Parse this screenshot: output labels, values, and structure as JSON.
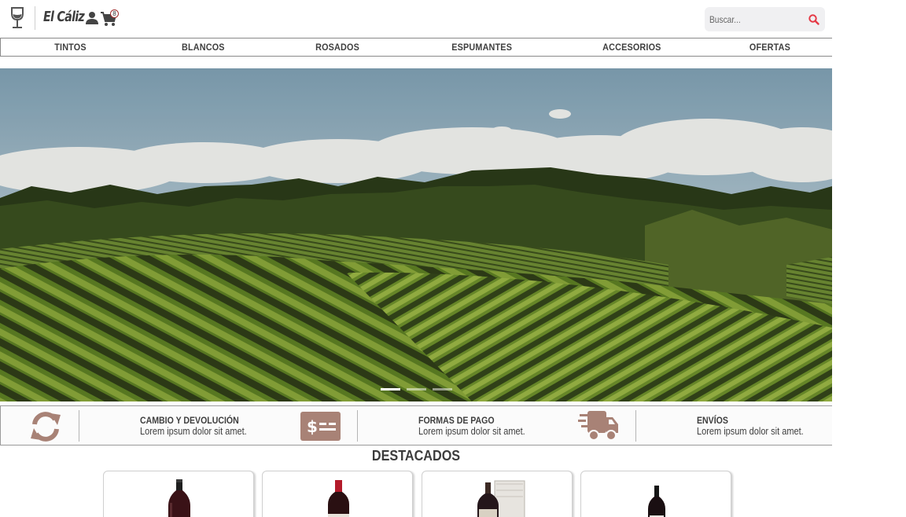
{
  "header": {
    "brand": "El Cáliz",
    "cart_count": "8",
    "search_placeholder": "Buscar..."
  },
  "nav": {
    "items": [
      "TINTOS",
      "BLANCOS",
      "ROSADOS",
      "ESPUMANTES",
      "ACCESORIOS",
      "OFERTAS"
    ]
  },
  "hero": {
    "slides_total": 3,
    "active_slide": 1
  },
  "features": [
    {
      "icon": "refresh-icon",
      "title": "CAMBIO Y DEVOLUCIÓN",
      "subtitle": "Lorem ipsum dolor sit amet."
    },
    {
      "icon": "payment-icon",
      "title": "FORMAS DE PAGO",
      "subtitle": "Lorem ipsum dolor sit amet."
    },
    {
      "icon": "truck-icon",
      "title": "ENVÍOS",
      "subtitle": "Lorem ipsum dolor sit amet."
    }
  ],
  "featured": {
    "title": "DESTACADOS",
    "products": [
      {
        "image": "wine-bottle-image"
      },
      {
        "image": "wine-bottle-image"
      },
      {
        "image": "wine-bottle-with-box-image"
      },
      {
        "image": "wine-bottle-image"
      }
    ]
  },
  "colors": {
    "accent_brown": "#a88276",
    "search_red": "#e53946",
    "text_dark": "#3e3e3e"
  }
}
